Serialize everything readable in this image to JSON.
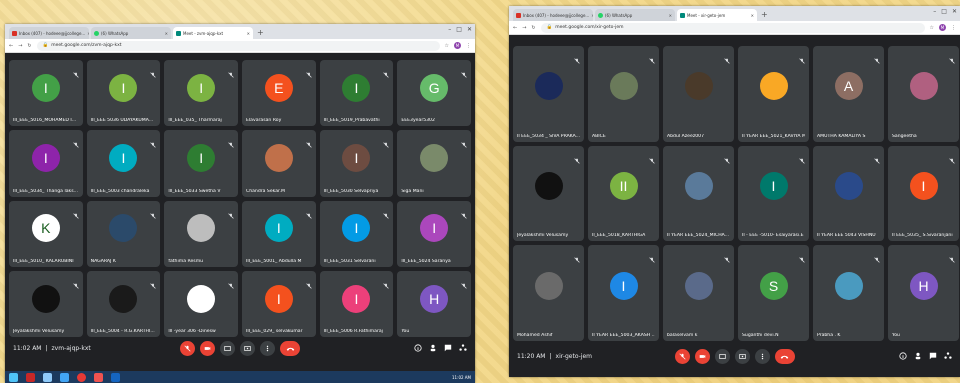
{
  "colors": {
    "background": "#f3d98a",
    "meet_dark": "#202124",
    "tile": "#3c4043",
    "red": "#ea4335"
  },
  "left": {
    "tabs": [
      {
        "label": "Inbox (407) - hodeee@jjcollege...",
        "icon_color": "#d93025",
        "active": false
      },
      {
        "label": "(6) WhatsApp",
        "icon_color": "#25d366",
        "active": false
      },
      {
        "label": "Meet - zvm-ajqp-kxt",
        "icon_color": "#00897b",
        "active": true
      }
    ],
    "url": "meet.google.com/zvm-ajqp-kxt",
    "profile_initial": "M",
    "participants": [
      {
        "name": "III_EEE_5016_MOHAMED I...",
        "initial": "I",
        "color": "#43a047"
      },
      {
        "name": "III_EEE 5036 UDAYAKUMA...",
        "initial": "I",
        "color": "#7cb342"
      },
      {
        "name": "III_EEE_035_ Tharmaraj",
        "initial": "I",
        "color": "#7cb342"
      },
      {
        "name": "Elavarasan Roy",
        "initial": "E",
        "color": "#f4511e"
      },
      {
        "name": "III_EEE_5019_Prabavathi",
        "initial": "I",
        "color": "#2e7d32"
      },
      {
        "name": "EEE3year5302",
        "initial": "G",
        "color": "#66bb6a"
      },
      {
        "name": "III_EEE_5034_ Thanga laks...",
        "initial": "I",
        "color": "#8e24aa"
      },
      {
        "name": "III_EEE_5003 chandraleka",
        "initial": "I",
        "color": "#00acc1"
      },
      {
        "name": "III_EEE_5033 Swetha V",
        "initial": "I",
        "color": "#2e7d32"
      },
      {
        "name": "Chandra Sekar.M",
        "initial": "",
        "color": "#c0704a"
      },
      {
        "name": "III_EEE_5030 Selvapriya",
        "initial": "I",
        "color": "#6d4c41"
      },
      {
        "name": "Siga Mani",
        "initial": "",
        "color": "#7a8a6a"
      },
      {
        "name": "III_EEE_5010_ KALARUBINI",
        "initial": "K",
        "color": "#ffffff"
      },
      {
        "name": "NAGARAJ K",
        "initial": "",
        "color": "#2b4a6a"
      },
      {
        "name": "fathima Resmu",
        "initial": "",
        "color": "#bdbdbd"
      },
      {
        "name": "III_EEE_5001_ Abdulla M",
        "initial": "I",
        "color": "#00acc1"
      },
      {
        "name": "III_EEE_5031 Selvarani",
        "initial": "I",
        "color": "#039be5"
      },
      {
        "name": "III_EEE_5024 Saranya",
        "initial": "I",
        "color": "#ab47bc"
      },
      {
        "name": "Jeyalakshmi Velusamy",
        "initial": "",
        "color": "#111111"
      },
      {
        "name": "III_EEE_5004 - R.G.KARTHI...",
        "initial": "",
        "color": "#1a1a1a"
      },
      {
        "name": "III -year 306 -Dinesw",
        "initial": "",
        "color": "#ffffff"
      },
      {
        "name": "III_EEE_029_ selvakumar",
        "initial": "I",
        "color": "#f4511e"
      },
      {
        "name": "III_EEE_5006 R.Fathimaraj",
        "initial": "I",
        "color": "#ec407a"
      },
      {
        "name": "You",
        "initial": "H",
        "color": "#7e57c2"
      }
    ],
    "meeting_info": {
      "time": "11:02 AM",
      "code": "zvm-ajqp-kxt"
    },
    "clock": "11:02 AM"
  },
  "right": {
    "tabs": [
      {
        "label": "Inbox (407) - hodeee@jjcollege...",
        "icon_color": "#d93025",
        "active": false
      },
      {
        "label": "(6) WhatsApp",
        "icon_color": "#25d366",
        "active": false
      },
      {
        "label": "Meet - xir-geto-jem",
        "icon_color": "#00897b",
        "active": true
      }
    ],
    "url": "meet.google.com/xir-geto-jem",
    "profile_initial": "M",
    "participants": [
      {
        "name": "II EEE_5034 _ SIVA PRAKA...",
        "initial": "",
        "color": "#1b2a5a"
      },
      {
        "name": "ABICE",
        "initial": "",
        "color": "#6a7a5a"
      },
      {
        "name": "Abdul Azeez007",
        "initial": "",
        "color": "#4a3a2a"
      },
      {
        "name": "II YEAR EEE_5021_KAVIYA M",
        "initial": "",
        "color": "#f9a825"
      },
      {
        "name": "AMUTHA KAMALIYA S",
        "initial": "A",
        "color": "#8d6e63"
      },
      {
        "name": "Sangeetha",
        "initial": "",
        "color": "#b06080"
      },
      {
        "name": "Jeyalakshmi Velusamy",
        "initial": "",
        "color": "#111111"
      },
      {
        "name": "II_EEE_5018_KARTHIGA",
        "initial": "II",
        "color": "#7cb342"
      },
      {
        "name": "II YEAR EEE_5024_MICHA...",
        "initial": "",
        "color": "#5a7a9a"
      },
      {
        "name": "II - EEE -5010- Esaiyarasi.E",
        "initial": "I",
        "color": "#00796b"
      },
      {
        "name": "II YEAR EEE 5043 VISHNU",
        "initial": "",
        "color": "#2a4a8a"
      },
      {
        "name": "II EEE_5035_ S.Sivaranjani",
        "initial": "I",
        "color": "#f4511e"
      },
      {
        "name": "Mohamed Ashif",
        "initial": "",
        "color": "#6a6a6a"
      },
      {
        "name": "II YEAR EEE_5003_AKASH ...",
        "initial": "I",
        "color": "#1e88e5"
      },
      {
        "name": "balaselvam k",
        "initial": "",
        "color": "#5a6a8a"
      },
      {
        "name": "Suganthi devi.N",
        "initial": "S",
        "color": "#43a047"
      },
      {
        "name": "Prabha . K",
        "initial": "",
        "color": "#4a9abf"
      },
      {
        "name": "You",
        "initial": "H",
        "color": "#7e57c2"
      }
    ],
    "meeting_info": {
      "time": "11:20 AM",
      "code": "xir-geto-jem"
    }
  }
}
